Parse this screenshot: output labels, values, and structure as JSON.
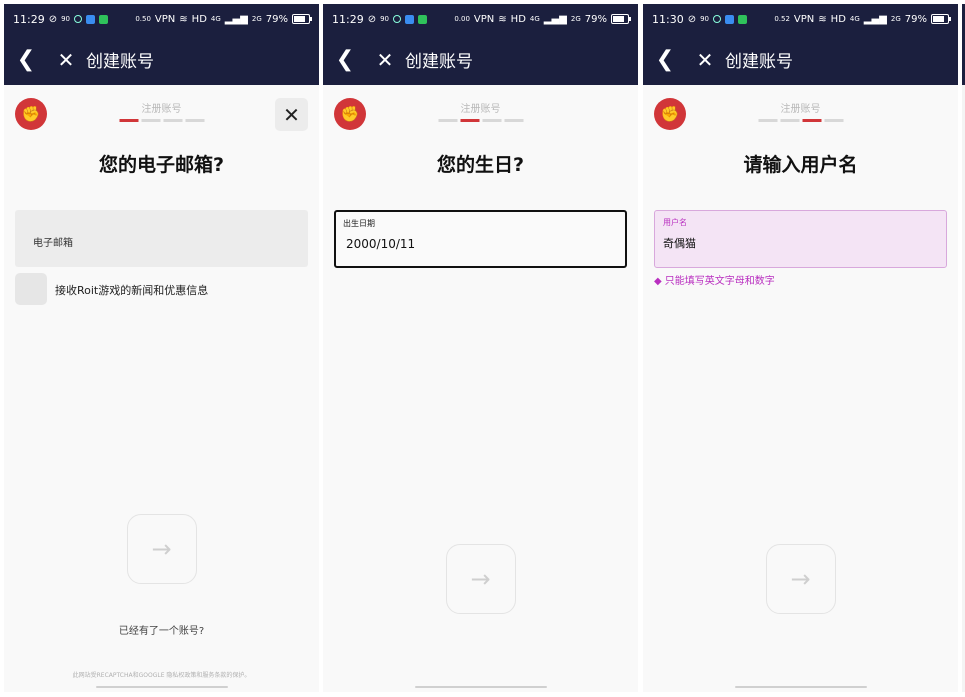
{
  "phones": [
    {
      "status": {
        "time": "11:29",
        "signal_left": "90",
        "speed_top": "0.50",
        "speed_bottom": "KB/S",
        "vpn": "VPN",
        "hd": "HD",
        "net4g": "4G",
        "net2g": "2G",
        "battery": "79%"
      },
      "appbar": {
        "title": "创建账号"
      },
      "step_label": "注册账号",
      "heading": "您的电子邮箱?",
      "email_field_label": "电子邮箱",
      "checkbox_label": "接收Roit游戏的新闻和优惠信息",
      "have_account": "已经有了一个账号?",
      "recaptcha": "此网站受RECAPTCHA和GOOGLE 隐私权政策和服务条款的保护。"
    },
    {
      "status": {
        "time": "11:29",
        "signal_left": "90",
        "speed_top": "0.00",
        "speed_bottom": "KB/S",
        "vpn": "VPN",
        "hd": "HD",
        "net4g": "4G",
        "net2g": "2G",
        "battery": "79%"
      },
      "appbar": {
        "title": "创建账号"
      },
      "step_label": "注册账号",
      "heading": "您的生日?",
      "date_label": "出生日期",
      "date_value": "2000/10/11"
    },
    {
      "status": {
        "time": "11:30",
        "signal_left": "90",
        "speed_top": "0.52",
        "speed_bottom": "KB/S",
        "vpn": "VPN",
        "hd": "HD",
        "net4g": "4G",
        "net2g": "2G",
        "battery": "79%"
      },
      "appbar": {
        "title": "创建账号"
      },
      "step_label": "注册账号",
      "heading": "请输入用户名",
      "username_label": "用户名",
      "username_value": "奇偶猫",
      "username_hint": "只能填写英文字母和数字"
    }
  ],
  "icons": {
    "back": "chevron-left-icon",
    "close": "close-icon",
    "logo": "riot-fist-logo",
    "next": "arrow-right-icon",
    "warning": "warning-diamond-icon"
  },
  "colors": {
    "appbar": "#1b1f3e",
    "accent": "#d13639",
    "error": "#b92fc0"
  }
}
